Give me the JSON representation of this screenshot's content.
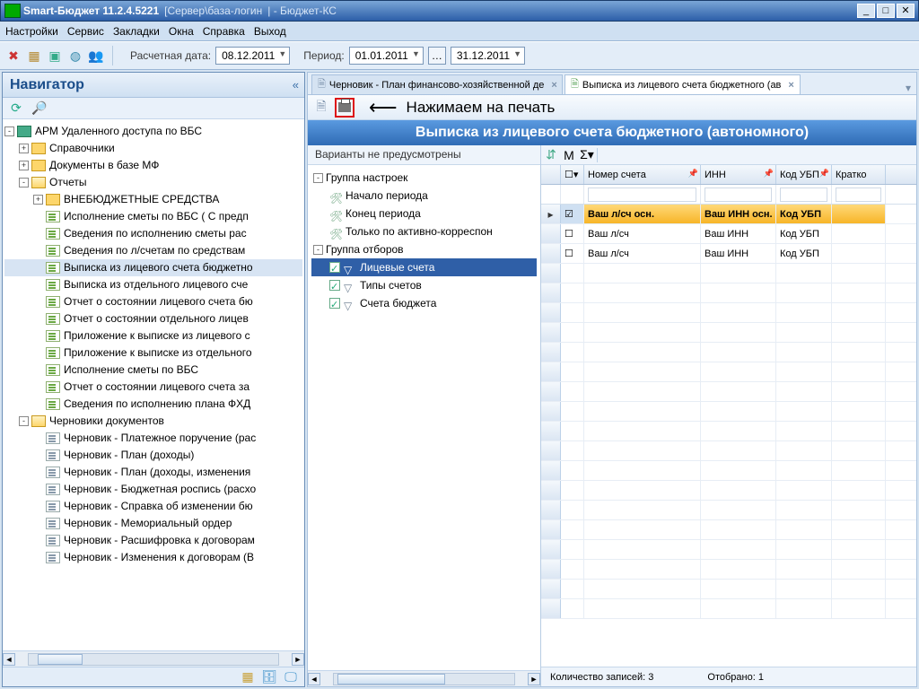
{
  "title": {
    "app": "Smart-Бюджет 11.2.4.5221",
    "conn": "[Сервер\\база-логин",
    "tail": "| - Бюджет-КС"
  },
  "menubar": [
    "Настройки",
    "Сервис",
    "Закладки",
    "Окна",
    "Справка",
    "Выход"
  ],
  "toolbar": {
    "calcdate_label": "Расчетная дата:",
    "calcdate": "08.12.2011",
    "period_label": "Период:",
    "from": "01.01.2011",
    "to": "31.12.2011"
  },
  "navigator": {
    "title": "Навигатор",
    "tree": [
      {
        "l": 0,
        "exp": "-",
        "ico": "book",
        "txt": "АРМ Удаленного доступа по ВБС"
      },
      {
        "l": 1,
        "exp": "+",
        "ico": "folder",
        "txt": "Справочники"
      },
      {
        "l": 1,
        "exp": "+",
        "ico": "folder",
        "txt": "Документы в базе МФ"
      },
      {
        "l": 1,
        "exp": "-",
        "ico": "folder open",
        "txt": "Отчеты"
      },
      {
        "l": 2,
        "exp": "+",
        "ico": "folder",
        "txt": "ВНЕБЮДЖЕТНЫЕ СРЕДСТВА"
      },
      {
        "l": 2,
        "exp": "",
        "ico": "doc",
        "txt": "Исполнение сметы по ВБС ( С предп"
      },
      {
        "l": 2,
        "exp": "",
        "ico": "doc",
        "txt": "Сведения по исполнению сметы рас"
      },
      {
        "l": 2,
        "exp": "",
        "ico": "doc",
        "txt": "Сведения по л/счетам по средствам"
      },
      {
        "l": 2,
        "exp": "",
        "ico": "doc",
        "txt": "Выписка из лицевого счета бюджетно",
        "sel": true
      },
      {
        "l": 2,
        "exp": "",
        "ico": "doc",
        "txt": "Выписка из отдельного лицевого сче"
      },
      {
        "l": 2,
        "exp": "",
        "ico": "doc",
        "txt": "Отчет о состоянии лицевого счета бю"
      },
      {
        "l": 2,
        "exp": "",
        "ico": "doc",
        "txt": "Отчет о состоянии отдельного лицев"
      },
      {
        "l": 2,
        "exp": "",
        "ico": "doc",
        "txt": "Приложение к выписке из лицевого с"
      },
      {
        "l": 2,
        "exp": "",
        "ico": "doc",
        "txt": "Приложение к выписке из отдельного"
      },
      {
        "l": 2,
        "exp": "",
        "ico": "doc",
        "txt": "Исполнение сметы по ВБС"
      },
      {
        "l": 2,
        "exp": "",
        "ico": "doc",
        "txt": "Отчет о состоянии лицевого счета за"
      },
      {
        "l": 2,
        "exp": "",
        "ico": "doc",
        "txt": "Сведения по исполнению плана ФХД"
      },
      {
        "l": 1,
        "exp": "-",
        "ico": "folder open",
        "txt": "Черновики документов"
      },
      {
        "l": 2,
        "exp": "",
        "ico": "doc grey",
        "txt": "Черновик - Платежное поручение (рас"
      },
      {
        "l": 2,
        "exp": "",
        "ico": "doc grey",
        "txt": "Черновик - План (доходы)"
      },
      {
        "l": 2,
        "exp": "",
        "ico": "doc grey",
        "txt": "Черновик - План (доходы, изменения"
      },
      {
        "l": 2,
        "exp": "",
        "ico": "doc grey",
        "txt": "Черновик - Бюджетная роспись (расхо"
      },
      {
        "l": 2,
        "exp": "",
        "ico": "doc grey",
        "txt": "Черновик - Справка об изменении бю"
      },
      {
        "l": 2,
        "exp": "",
        "ico": "doc grey",
        "txt": "Черновик - Мемориальный ордер"
      },
      {
        "l": 2,
        "exp": "",
        "ico": "doc grey",
        "txt": "Черновик - Расшифровка к договорам"
      },
      {
        "l": 2,
        "exp": "",
        "ico": "doc grey",
        "txt": "Черновик - Изменения к договорам (В"
      }
    ]
  },
  "tabs": [
    {
      "label": "Черновик - План финансово-хозяйственной де",
      "active": false
    },
    {
      "label": "Выписка из лицевого счета бюджетного (ав",
      "active": true
    }
  ],
  "annotation": "Нажимаем на печать",
  "banner": "Выписка из лицевого счета бюджетного (автономного)",
  "settings": {
    "head": "Варианты не предусмотрены",
    "rows": [
      {
        "l": 0,
        "exp": "-",
        "txt": "Группа настроек"
      },
      {
        "l": 1,
        "ico": "wrench",
        "txt": "Начало периода"
      },
      {
        "l": 1,
        "ico": "wrench",
        "txt": "Конец периода"
      },
      {
        "l": 1,
        "ico": "wrench",
        "txt": "Только по активно-корреспон"
      },
      {
        "l": 0,
        "exp": "-",
        "txt": "Группа отборов"
      },
      {
        "l": 1,
        "chk": true,
        "ico": "filter",
        "txt": "Лицевые счета",
        "sel": true
      },
      {
        "l": 1,
        "chk": true,
        "ico": "filter",
        "txt": "Типы счетов"
      },
      {
        "l": 1,
        "chk": true,
        "ico": "filter",
        "txt": "Счета бюджета"
      }
    ]
  },
  "grid": {
    "columns": [
      "",
      "M",
      "Номер счета",
      "ИНН",
      "Код УБП",
      "Кратко"
    ],
    "rows": [
      {
        "sel": true,
        "cells": [
          "",
          "☑",
          "Ваш л/сч осн.",
          "Ваш ИНН осн.",
          "Код УБП",
          ""
        ]
      },
      {
        "cells": [
          "",
          "☐",
          "Ваш л/сч",
          "Ваш ИНН",
          "Код УБП",
          ""
        ]
      },
      {
        "cells": [
          "",
          "☐",
          "Ваш л/сч",
          "Ваш ИНН",
          "Код УБП",
          ""
        ]
      }
    ],
    "status_count": "Количество записей: 3",
    "status_sel": "Отобрано: 1"
  }
}
